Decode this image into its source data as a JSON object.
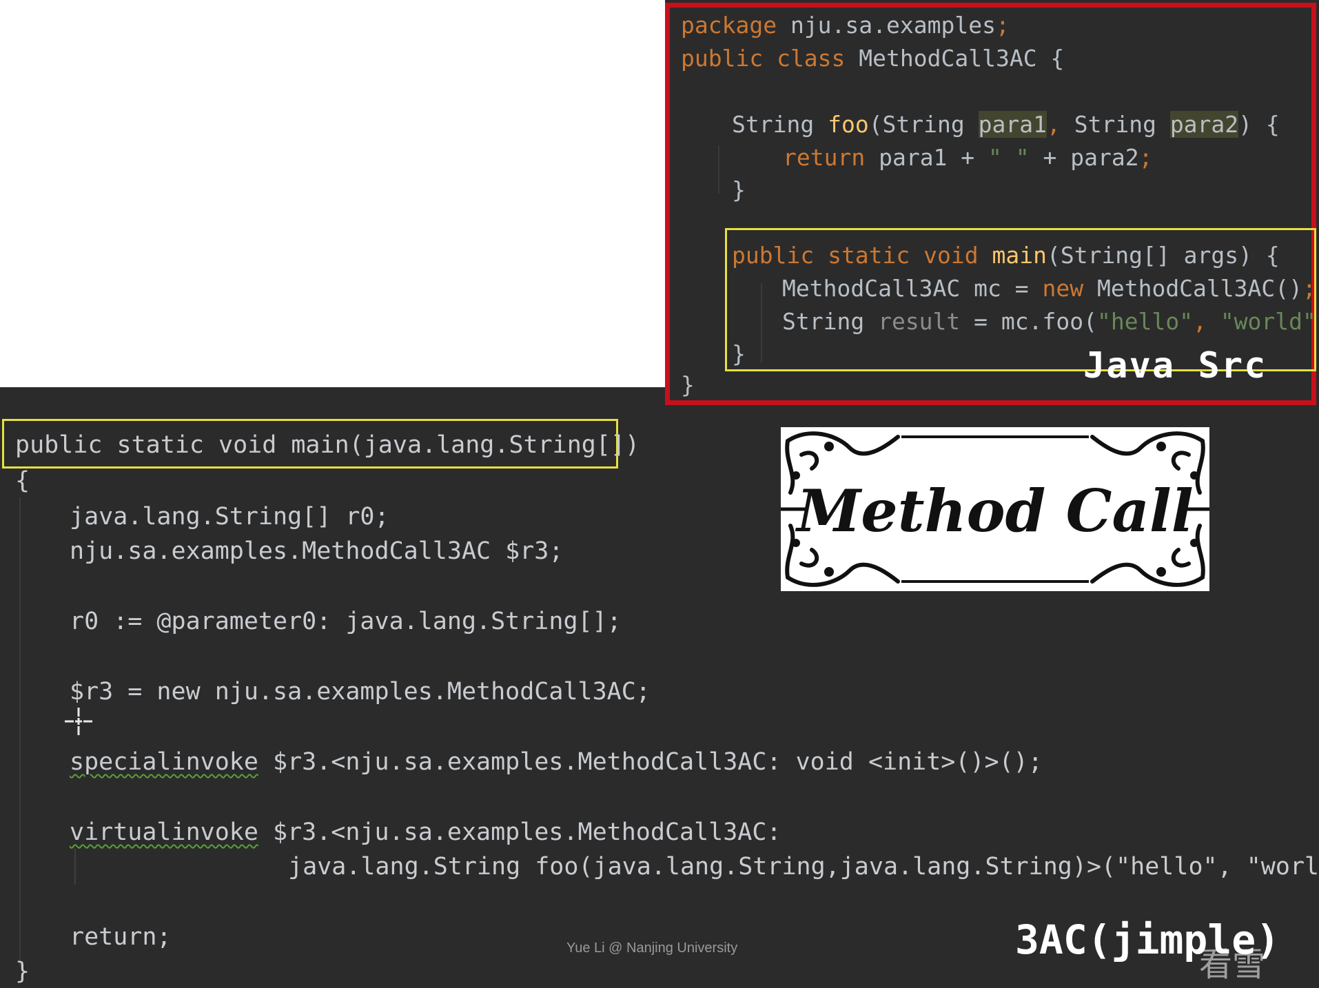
{
  "java_src": {
    "label": "Java Src",
    "lines": {
      "l1_kw": "package",
      "l1_rest": " nju.sa.examples",
      "l1_semi": ";",
      "l2_kw": "public class",
      "l2_rest": " MethodCall3AC {",
      "l3_type": "String ",
      "l3_fn": "foo",
      "l3_open": "(String ",
      "l3_p1": "para1",
      "l3_comma": ", ",
      "l3_type2": "String ",
      "l3_p2": "para2",
      "l3_close": ") {",
      "l4_kw": "return",
      "l4_a": " para1 + ",
      "l4_str": "\" \"",
      "l4_b": " + para2",
      "l4_semi": ";",
      "l5": "}",
      "l6_kw": "public static void",
      "l6_fn": " main",
      "l6_rest": "(String[] args) {",
      "l7_a": "MethodCall3AC mc = ",
      "l7_kw": "new",
      "l7_b": " MethodCall3AC()",
      "l7_semi": ";",
      "l8_a": "String ",
      "l8_gray": "result",
      "l8_b": " = mc.foo(",
      "l8_s1": "\"hello\"",
      "l8_c": ", ",
      "l8_s2": "\"world\"",
      "l8_d": ");",
      "l9": "}",
      "l10": "}"
    }
  },
  "jimple": {
    "label": "3AC(jimple)",
    "signature": "public static void main(java.lang.String[])",
    "open_brace": "{",
    "decl1": "java.lang.String[] r0;",
    "decl2": "nju.sa.examples.MethodCall3AC $r3;",
    "param": "r0 := @parameter0: java.lang.String[];",
    "new_stmt": "$r3 = new nju.sa.examples.MethodCall3AC;",
    "special_kw": "specialinvoke",
    "special_rest": " $r3.<nju.sa.examples.MethodCall3AC: void <init>()>();",
    "virtual_kw": "virtualinvoke",
    "virtual_rest": " $r3.<nju.sa.examples.MethodCall3AC:",
    "virtual_cont": "java.lang.String foo(java.lang.String,java.lang.String)>(\"hello\", \"world\");",
    "ret": "return;",
    "close_brace": "}"
  },
  "banner": {
    "title": "Method Call"
  },
  "footer": "Yue Li @ Nanjing University",
  "watermark": "看雪",
  "colors": {
    "keyword": "#cc7832",
    "function": "#ffc66d",
    "string": "#6a8759",
    "frame_red": "#c8101c",
    "highlight_yellow": "#e6e040",
    "background": "#2b2b2b"
  }
}
